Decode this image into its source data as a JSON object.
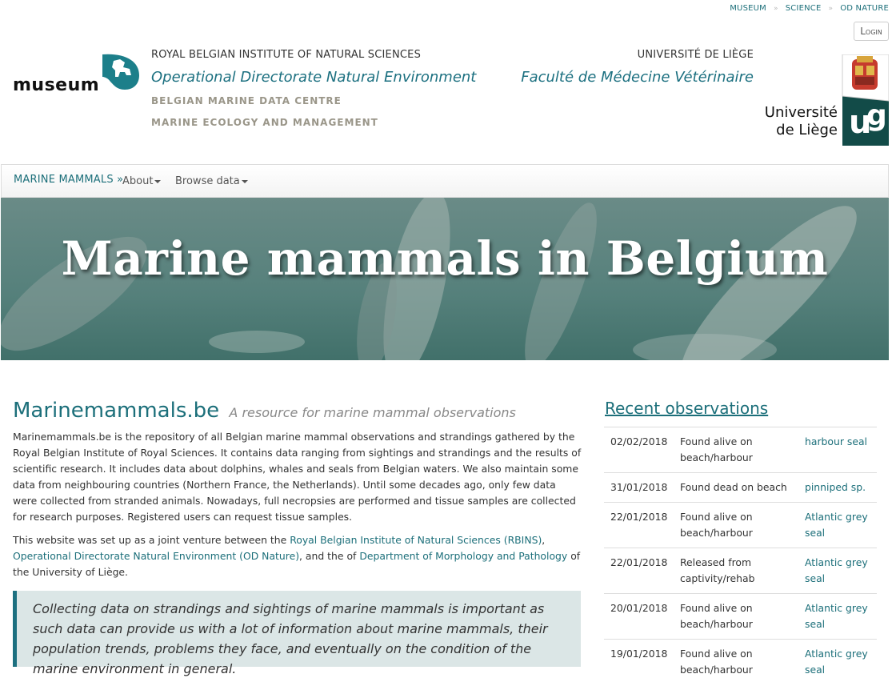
{
  "topnav": [
    "MUSEUM",
    "SCIENCE",
    "OD NATURE"
  ],
  "login": "Login",
  "header": {
    "museum_logo": "museum",
    "rbins": "ROYAL BELGIAN INSTITUTE OF NATURAL SCIENCES",
    "odnature": "Operational Directorate Natural Environment",
    "bmdc": "BELGIAN MARINE DATA CENTRE",
    "mem": "MARINE ECOLOGY AND MANAGEMENT",
    "ulg": "UNIVERSITÉ DE LIÈGE",
    "fmv": "Faculté de Médecine Vétérinaire",
    "ulg_logo_line1": "Université",
    "ulg_logo_line2": "de Liège"
  },
  "navbar": {
    "brand": "MARINE MAMMALS »",
    "items": [
      "About",
      "Browse data"
    ]
  },
  "hero": {
    "title": "Marine mammals in Belgium"
  },
  "main": {
    "title": "Marinemammals.be",
    "subtitle": "A resource for marine mammal observations",
    "para1": "Marinemammals.be is the repository of all Belgian marine mammal observations and strandings gathered by the Royal Belgian Institute of Royal Sciences. It contains data ranging from sightings and strandings and the results of scientific research. It includes data about dolphins, whales and seals from Belgian waters. We also maintain some data from neighbouring countries (Northern France, the Netherlands). Until some decades ago, only few data were collected from stranded animals. Nowadays, full necropsies are performed and tissue samples are collected for research purposes. Registered users can request tissue samples.",
    "para2_a": "This website was set up as a joint venture between the ",
    "link_rbins": "Royal Belgian Institute of Natural Sciences (RBINS)",
    "para2_b": ",",
    "link_od": "Operational Directorate Natural Environment (OD Nature)",
    "para2_c": ", and the of ",
    "link_dept": "Department of Morphology and Pathology",
    "para2_d": " of the University of Liège.",
    "quote": "Collecting data on strandings and sightings of marine mammals is important as such data can provide us with a lot of information about marine mammals, their population trends, problems they face, and eventually on the condition of the marine environment in general."
  },
  "sidebar": {
    "title": "Recent observations",
    "rows": [
      {
        "date": "02/02/2018",
        "type": "Found alive on beach/harbour",
        "species": "harbour seal"
      },
      {
        "date": "31/01/2018",
        "type": "Found dead on beach",
        "species": "pinniped sp."
      },
      {
        "date": "22/01/2018",
        "type": "Found alive on beach/harbour",
        "species": "Atlantic grey seal"
      },
      {
        "date": "22/01/2018",
        "type": "Released from captivity/rehab",
        "species": "Atlantic grey seal"
      },
      {
        "date": "20/01/2018",
        "type": "Found alive on beach/harbour",
        "species": "Atlantic grey seal"
      },
      {
        "date": "19/01/2018",
        "type": "Found alive on beach/harbour",
        "species": "Atlantic grey seal"
      }
    ]
  },
  "colors": {
    "accent": "#1c6f7a",
    "muted": "#9a9689",
    "quote_bg": "#dbe6e6"
  }
}
